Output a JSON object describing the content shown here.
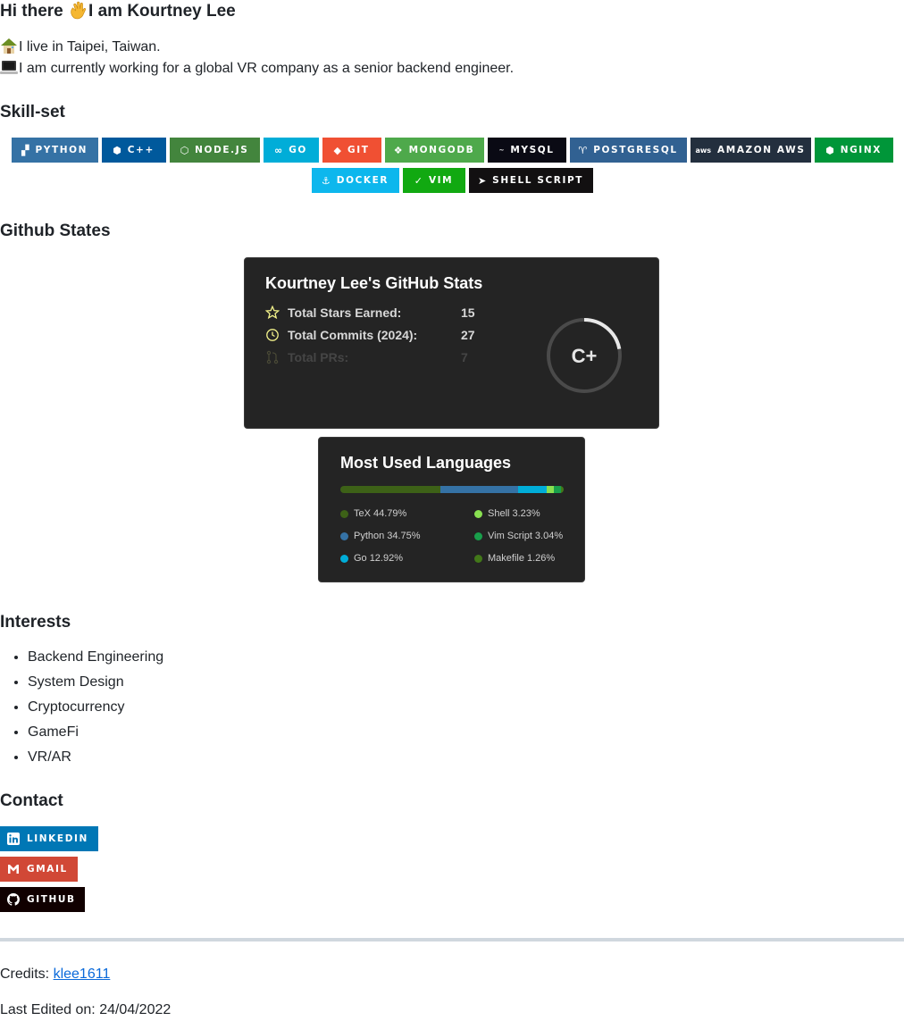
{
  "intro": {
    "greeting_pre": "Hi there ",
    "greeting_post": "I am Kourtney Lee",
    "line1": "I live in Taipei, Taiwan.",
    "line2": "I am currently working for a global VR company as a senior backend engineer."
  },
  "skillset": {
    "heading": "Skill-set",
    "badges_row1": [
      {
        "label": "PYTHON",
        "color": "#3572A5",
        "icon": "python-icon"
      },
      {
        "label": "C++",
        "color": "#00599C",
        "icon": "cplusplus-icon"
      },
      {
        "label": "NODE.JS",
        "color": "#43853D",
        "icon": "nodejs-icon"
      },
      {
        "label": "GO",
        "color": "#00ADD8",
        "icon": "go-icon"
      },
      {
        "label": "GIT",
        "color": "#F05033",
        "icon": "git-icon"
      },
      {
        "label": "MONGODB",
        "color": "#4EA94B",
        "icon": "mongodb-icon"
      },
      {
        "label": "MYSQL",
        "color": "#0A0A14",
        "icon": "mysql-icon"
      },
      {
        "label": "POSTGRESQL",
        "color": "#316192",
        "icon": "postgresql-icon"
      },
      {
        "label": "AMAZON AWS",
        "color": "#232F3E",
        "icon": "aws-icon"
      },
      {
        "label": "NGINX",
        "color": "#009639",
        "icon": "nginx-icon"
      }
    ],
    "badges_row2": [
      {
        "label": "DOCKER",
        "color": "#0DB7ED",
        "icon": "docker-icon"
      },
      {
        "label": "VIM",
        "color": "#11A911",
        "icon": "vim-icon"
      },
      {
        "label": "SHELL SCRIPT",
        "color": "#121011",
        "icon": "shell-icon"
      }
    ]
  },
  "github": {
    "heading": "Github States",
    "stats_card": {
      "title": "Kourtney Lee's GitHub Stats",
      "rows": [
        {
          "label": "Total Stars Earned:",
          "value": "15",
          "icon": "star-icon"
        },
        {
          "label": "Total Commits (2024):",
          "value": "27",
          "icon": "history-icon"
        },
        {
          "label": "Total PRs:",
          "value": "7",
          "icon": "pull-request-icon"
        }
      ],
      "grade": "C+",
      "grade_progress": 0.22
    },
    "langs_card": {
      "title": "Most Used Languages",
      "languages": [
        {
          "name": "TeX",
          "percent": "44.79%",
          "value": 44.79,
          "color": "#3D6117"
        },
        {
          "name": "Python",
          "percent": "34.75%",
          "value": 34.75,
          "color": "#3572A5"
        },
        {
          "name": "Go",
          "percent": "12.92%",
          "value": 12.92,
          "color": "#00ADD8"
        },
        {
          "name": "Shell",
          "percent": "3.23%",
          "value": 3.23,
          "color": "#89E051"
        },
        {
          "name": "Vim Script",
          "percent": "3.04%",
          "value": 3.04,
          "color": "#199F4B"
        },
        {
          "name": "Makefile",
          "percent": "1.26%",
          "value": 1.26,
          "color": "#427819"
        }
      ]
    }
  },
  "interests": {
    "heading": "Interests",
    "items": [
      "Backend Engineering",
      "System Design",
      "Cryptocurrency",
      "GameFi",
      "VR/AR"
    ]
  },
  "contact": {
    "heading": "Contact",
    "badges": [
      {
        "label": "LINKEDIN",
        "color": "#0077B5",
        "icon": "linkedin-icon"
      },
      {
        "label": "GMAIL",
        "color": "#D14836",
        "icon": "gmail-icon"
      },
      {
        "label": "GITHUB",
        "color": "#100000",
        "icon": "github-icon"
      }
    ]
  },
  "footer": {
    "credits_label": "Credits: ",
    "credits_link": "klee1611",
    "last_edited": "Last Edited on: 24/04/2022"
  }
}
